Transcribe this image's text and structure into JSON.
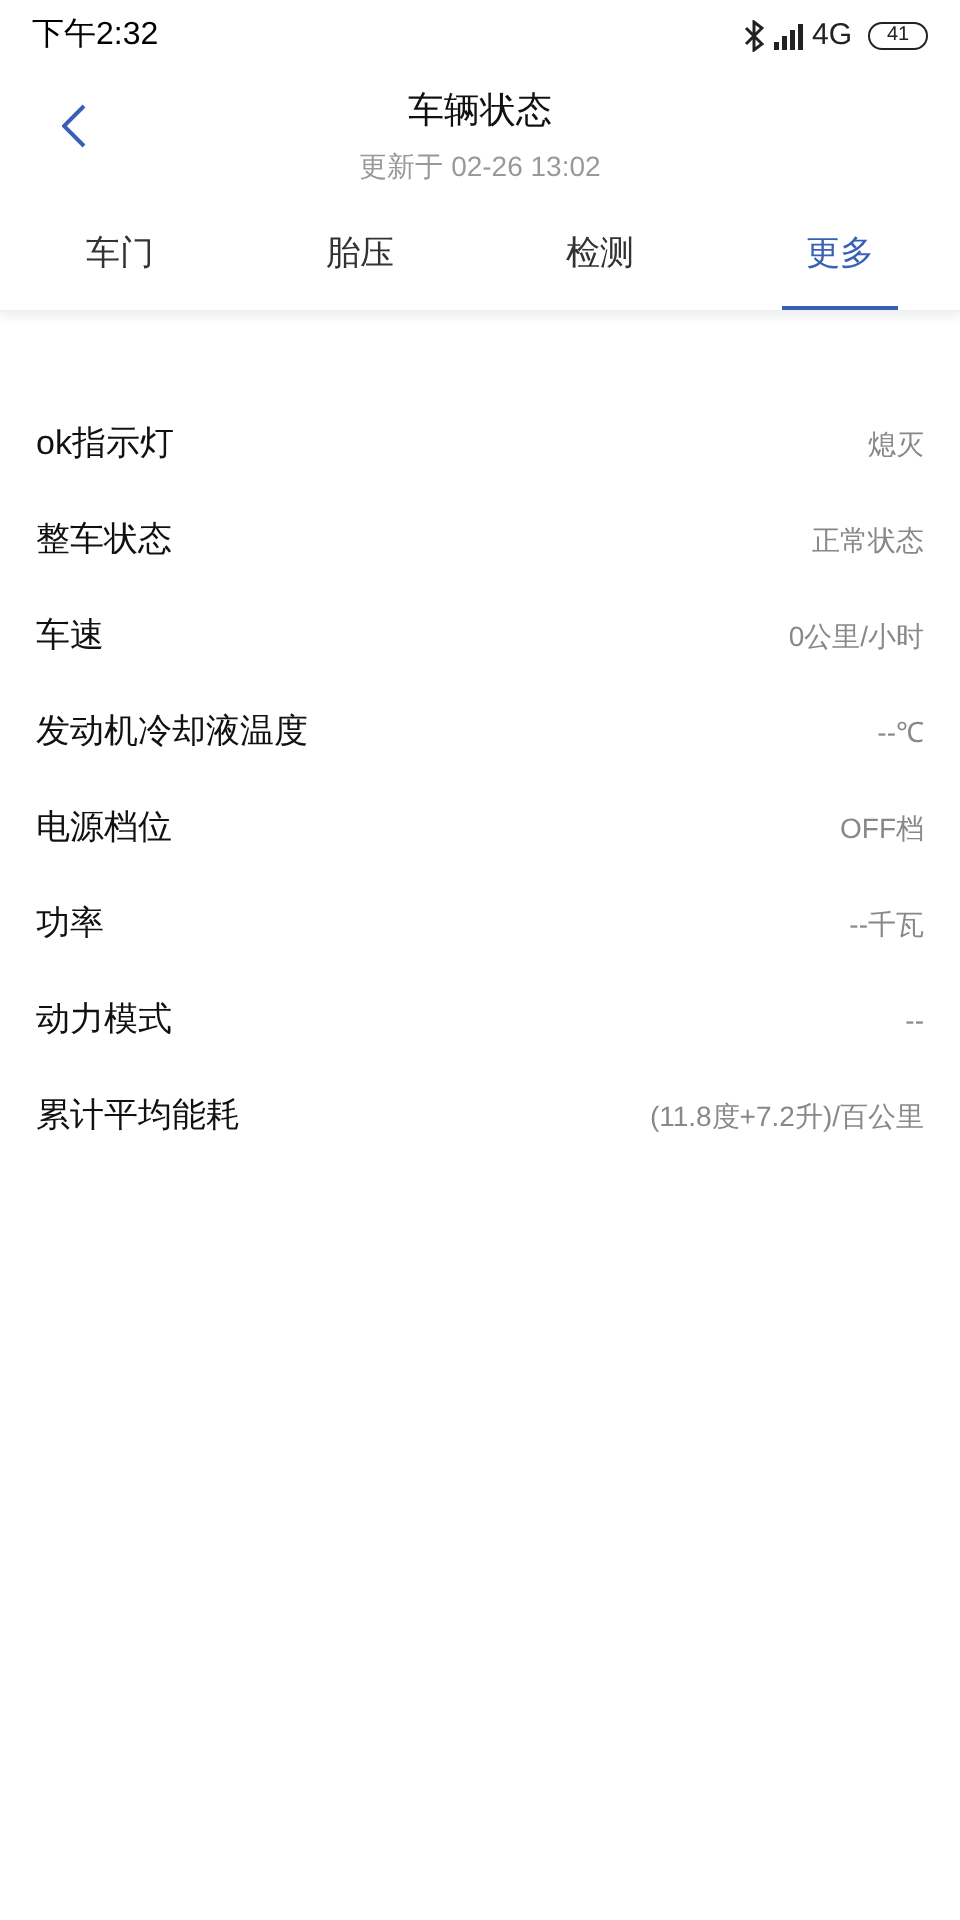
{
  "status_bar": {
    "time": "下午2:32",
    "network": "4G",
    "battery": "41"
  },
  "header": {
    "title": "车辆状态",
    "subtitle": "更新于 02-26 13:02"
  },
  "tabs": [
    {
      "label": "车门",
      "selected": false
    },
    {
      "label": "胎压",
      "selected": false
    },
    {
      "label": "检测",
      "selected": false
    },
    {
      "label": "更多",
      "selected": true
    }
  ],
  "rows": [
    {
      "label": "ok指示灯",
      "value": "熄灭"
    },
    {
      "label": "整车状态",
      "value": "正常状态"
    },
    {
      "label": "车速",
      "value": "0公里/小时"
    },
    {
      "label": "发动机冷却液温度",
      "value": "--℃"
    },
    {
      "label": "电源档位",
      "value": "OFF档"
    },
    {
      "label": "功率",
      "value": "--千瓦"
    },
    {
      "label": "动力模式",
      "value": "--"
    },
    {
      "label": "累计平均能耗",
      "value": "(11.8度+7.2升)/百公里"
    }
  ]
}
